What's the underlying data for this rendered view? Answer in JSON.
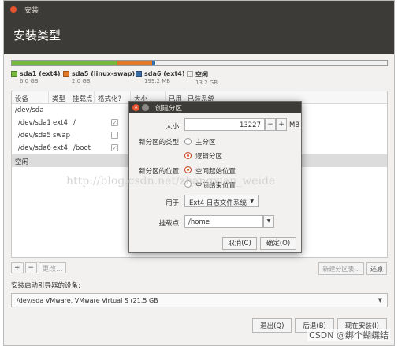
{
  "window": {
    "small_title": "安装",
    "page_title": "安装类型"
  },
  "partition_bar": {
    "segments": [
      {
        "name": "sda1 (ext4)",
        "size": "6.0 GB",
        "color": "#75b93f",
        "fraction": 0.28
      },
      {
        "name": "sda5 (linux-swap)",
        "size": "2.0 GB",
        "color": "#e07a2a",
        "fraction": 0.093
      },
      {
        "name": "sda6 (ext4)",
        "size": "199.2 MB",
        "color": "#3a6ea5",
        "fraction": 0.009
      },
      {
        "name": "空闲",
        "size": "13.2 GB",
        "color": "#f0f0f0",
        "fraction": 0.618
      }
    ]
  },
  "table": {
    "headers": [
      "设备",
      "类型",
      "挂载点",
      "格式化?",
      "大小",
      "已用",
      "已装系统"
    ],
    "rows": [
      {
        "device": "/dev/sda",
        "type": "",
        "mount": "",
        "format": null
      },
      {
        "device": "/dev/sda1",
        "type": "ext4",
        "mount": "/",
        "format": true
      },
      {
        "device": "/dev/sda5",
        "type": "swap",
        "mount": "",
        "format": false
      },
      {
        "device": "/dev/sda6",
        "type": "ext4",
        "mount": "/boot",
        "format": true
      },
      {
        "device": "空闲",
        "type": "",
        "mount": "",
        "format": null
      }
    ]
  },
  "table_tools": {
    "add": "+",
    "remove": "−",
    "change": "更改...",
    "new_table": "新建分区表...",
    "revert": "还原"
  },
  "boot": {
    "label": "安装启动引导器的设备:",
    "value": "/dev/sda   VMware, VMware Virtual S (21.5 GB"
  },
  "footer": {
    "quit": "退出(Q)",
    "back": "后退(B)",
    "install": "现在安装(I)"
  },
  "dialog": {
    "title": "创建分区",
    "size_label": "大小:",
    "size_value": "13227",
    "minus": "−",
    "plus": "+",
    "unit": "MB",
    "type_label": "新分区的类型:",
    "type_options": [
      "主分区",
      "逻辑分区"
    ],
    "type_selected": 1,
    "location_label": "新分区的位置:",
    "location_options": [
      "空间起始位置",
      "空间结束位置"
    ],
    "location_selected": 0,
    "use_label": "用于:",
    "use_value": "Ext4 日志文件系统",
    "mount_label": "挂载点:",
    "mount_value": "/home",
    "cancel": "取消(C)",
    "ok": "确定(O)"
  },
  "watermark": "http://blog.csdn.net/zhangxian_weide",
  "csdn_credit": "CSDN @绑个蝴蝶结",
  "colors": {
    "accent": "#e5532d",
    "titlebar": "#3c3b37"
  }
}
